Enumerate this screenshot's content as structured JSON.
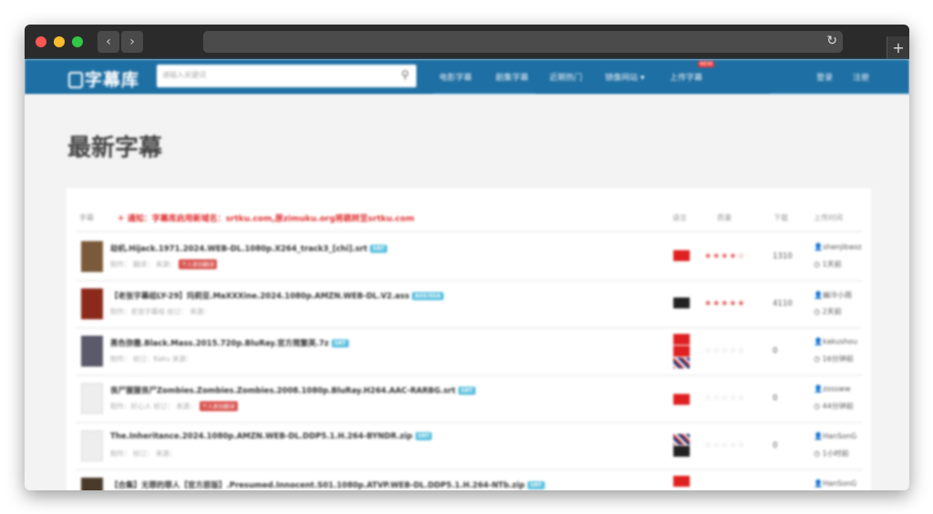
{
  "site": {
    "logo": "字幕库",
    "search_placeholder": "请输入关键词",
    "nav": [
      "电影字幕",
      "剧集字幕",
      "近期热门",
      "镜像网站 ▾",
      "上传字幕"
    ],
    "new_badge": "NEW",
    "login": "登录",
    "register": "注册"
  },
  "page": {
    "title": "最新字幕",
    "columns": {
      "subtitle": "字幕",
      "lang": "语言",
      "rating": "质量",
      "downloads": "下载",
      "uploader": "上传时间"
    },
    "notice": "通知：字幕库启用新域名：srtku.com,原zimuku.org将跳转至srtku.com",
    "rows": [
      {
        "title": "劫机.Hijack.1971.2024.WEB-DL.1080p.X264_track3_[chi].srt",
        "tag": "SRT",
        "meta": "制作：   翻译：   来源：",
        "badge": "个人原创翻译",
        "stars": "★★★★☆",
        "downloads": "1310",
        "user": "shenjibaoz",
        "time": "1天前"
      },
      {
        "title": "【老张字幕组LY-29】玛莉亚.MaXXXine.2024.1080p.AMZN.WEB-DL.V2.ass",
        "tag": "ASS/SSA",
        "meta": "制作：老张字幕组  校订：   来源：",
        "badge": "",
        "stars": "★★★★★",
        "downloads": "4110",
        "user": "幽冷小雨",
        "time": "2天前"
      },
      {
        "title": "黑色弥撒.Black.Mass.2015.720p.BluRay.官方简繁英.7z",
        "tag": "SRT",
        "meta": "制作：   校订：Kaku 来源：",
        "badge": "",
        "stars": "☆☆☆☆☆",
        "downloads": "0",
        "user": "kakushou",
        "time": "16分钟前"
      },
      {
        "title": "丧尸猩猩丧尸Zombies.Zombies.Zombies.2008.1080p.BluRay.H264.AAC-RARBG.srt",
        "tag": "SRT",
        "meta": "制作：好心人 校订：   来源：",
        "badge": "个人原创翻译",
        "stars": "☆☆☆☆☆",
        "downloads": "0",
        "user": "zossww",
        "time": "44分钟前"
      },
      {
        "title": "The.Inheritance.2024.1080p.AMZN.WEB-DL.DDP5.1.H.264-BYNDR.zip",
        "tag": "SRT",
        "meta": "制作：   校订：   来源：",
        "badge": "",
        "stars": "☆☆☆☆☆",
        "downloads": "0",
        "user": "HanSonG",
        "time": "1小时前"
      },
      {
        "title": "【合集】无罪的罪人【官方原版】.Presumed.Innocent.S01.1080p.ATVP.WEB-DL.DDP5.1.H.264-NTb.zip",
        "tag": "SRT",
        "meta": "",
        "badge": "",
        "stars": "",
        "downloads": "",
        "user": "HanSonG",
        "time": ""
      }
    ]
  },
  "colors": {
    "brand": "#1e6fa3",
    "notice": "#e03030",
    "star": "#e05050"
  }
}
